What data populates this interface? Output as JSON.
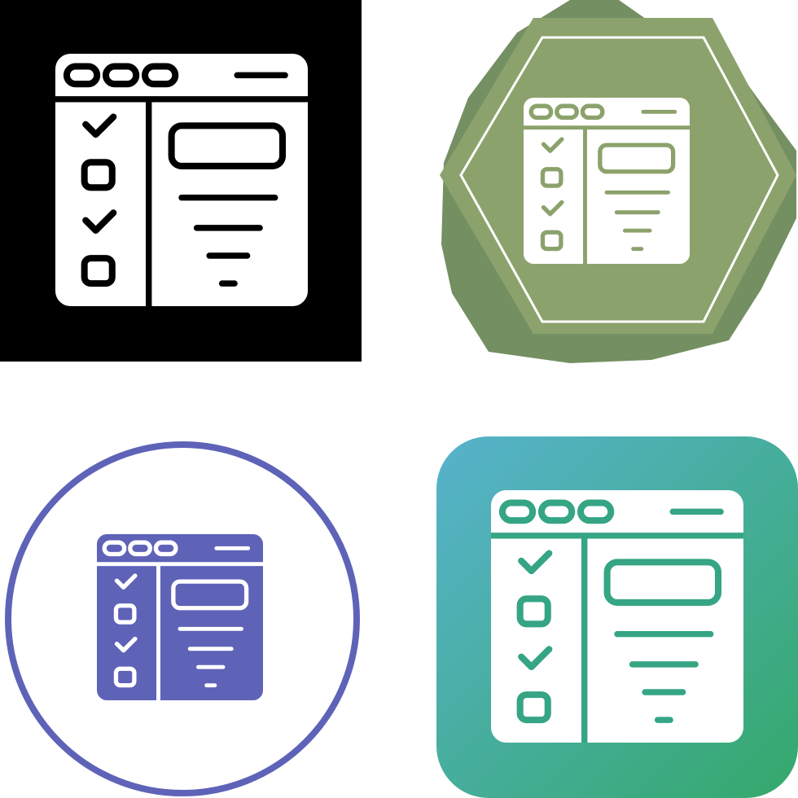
{
  "icon_set": {
    "variants": [
      {
        "style": "glyph",
        "background_icon": "black-square",
        "background": "#000000",
        "icon_fill": "#ffffff",
        "icon_detail": "#000000"
      },
      {
        "style": "badge",
        "background_icon": "octagon-badge",
        "background_outer": "#748f62",
        "background_inner": "#8ca26c",
        "ring": "#ffffff",
        "icon_fill": "#ffffff",
        "icon_detail": "#8ca26c"
      },
      {
        "style": "circle",
        "background_icon": "circle-outline",
        "ring": "#5e63b8",
        "icon_fill": "#5e63b8",
        "icon_detail": "#ffffff"
      },
      {
        "style": "gradient",
        "background_icon": "rounded-square",
        "gradient_from": "#57b3cc",
        "gradient_to": "#35a86b",
        "icon_fill": "#ffffff",
        "icon_detail": "#35a584"
      }
    ],
    "icon_name": "browser-checklist-icon"
  }
}
